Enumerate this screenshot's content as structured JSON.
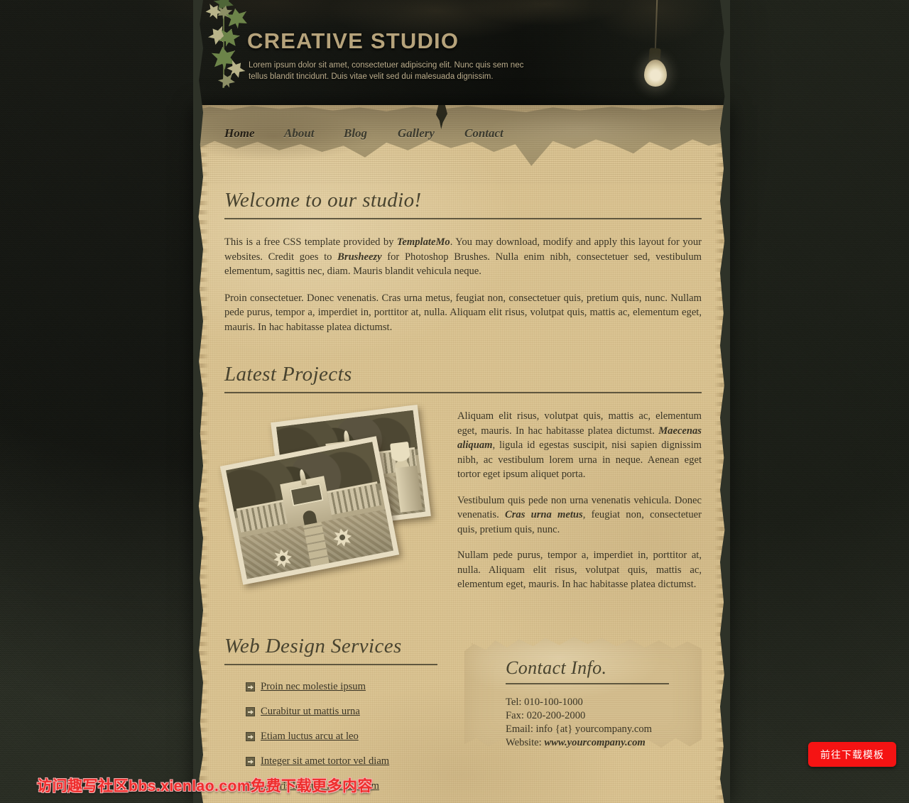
{
  "site": {
    "brand_title": "CREATIVE STUDIO",
    "tagline": "Lorem ipsum dolor sit amet, consectetuer adipiscing elit. Nunc quis sem nec tellus blandit tincidunt. Duis vitae velit sed dui malesuada dignissim."
  },
  "nav": {
    "items": [
      {
        "label": "Home",
        "active": true
      },
      {
        "label": "About",
        "active": false
      },
      {
        "label": "Blog",
        "active": false
      },
      {
        "label": "Gallery",
        "active": false
      },
      {
        "label": "Contact",
        "active": false
      }
    ]
  },
  "welcome": {
    "title": "Welcome to our studio!",
    "p1_a": "This is a free CSS template provided by ",
    "p1_link1": "TemplateMo",
    "p1_b": ". You may download, modify and apply this layout for your websites. Credit goes to ",
    "p1_link2": "Brusheezy",
    "p1_c": " for Photoshop Brushes. Nulla enim nibh, consectetuer sed, vestibulum elementum, sagittis nec, diam. Mauris blandit vehicula neque.",
    "p2": "Proin consectetuer. Donec venenatis. Cras urna metus, feugiat non, consectetuer quis, pretium quis, nunc. Nullam pede purus, tempor a, imperdiet in, porttitor at, nulla. Aliquam elit risus, volutpat quis, mattis ac, elementum eget, mauris. In hac habitasse platea dictumst."
  },
  "projects": {
    "title": "Latest Projects",
    "p1_a": "Aliquam elit risus, volutpat quis, mattis ac, elementum eget, mauris. In hac habitasse platea dictumst. ",
    "p1_em": "Maecenas aliquam",
    "p1_b": ", ligula id egestas suscipit, nisi sapien dignissim nibh, ac vestibulum lorem urna in neque. Aenean eget tortor eget ipsum aliquet porta.",
    "p2_a": "Vestibulum quis pede non urna venenatis vehicula. Donec venenatis. ",
    "p2_em": "Cras urna metus",
    "p2_b": ", feugiat non, consectetuer quis, pretium quis, nunc.",
    "p3": "Nullam pede purus, tempor a, imperdiet in, porttitor at, nulla. Aliquam elit risus, volutpat quis, mattis ac, elementum eget, mauris. In hac habitasse platea dictumst.",
    "photo_back_alt": "sepia-photo-palace-facade",
    "photo_front_alt": "sepia-photo-palace-garden"
  },
  "services": {
    "title": "Web Design Services",
    "items": [
      "Proin nec molestie ipsum",
      "Curabitur ut mattis urna",
      "Etiam luctus arcu at leo",
      "Integer sit amet tortor vel diam",
      "Mauris lobortis nisl id lorem"
    ]
  },
  "contact": {
    "title": "Contact Info.",
    "tel": "Tel: 010-100-1000",
    "fax": "Fax: 020-200-2000",
    "email": "Email: info {at} yourcompany.com",
    "website_label": "Website: ",
    "website_value": "www.yourcompany.com"
  },
  "overlay": {
    "watermark": "访问趣写社区bbs.xienlao.com免费下载更多内容",
    "download_button": "前往下载模板"
  },
  "colors": {
    "paper": "#d7bf8c",
    "wall": "#2e3228",
    "brand": "#b6a37b",
    "ink": "#3a3526",
    "rule": "#4a4430",
    "accent_red": "#f51313",
    "watermark_red": "#ef2d2d",
    "leaf_green": "#6c8449"
  }
}
